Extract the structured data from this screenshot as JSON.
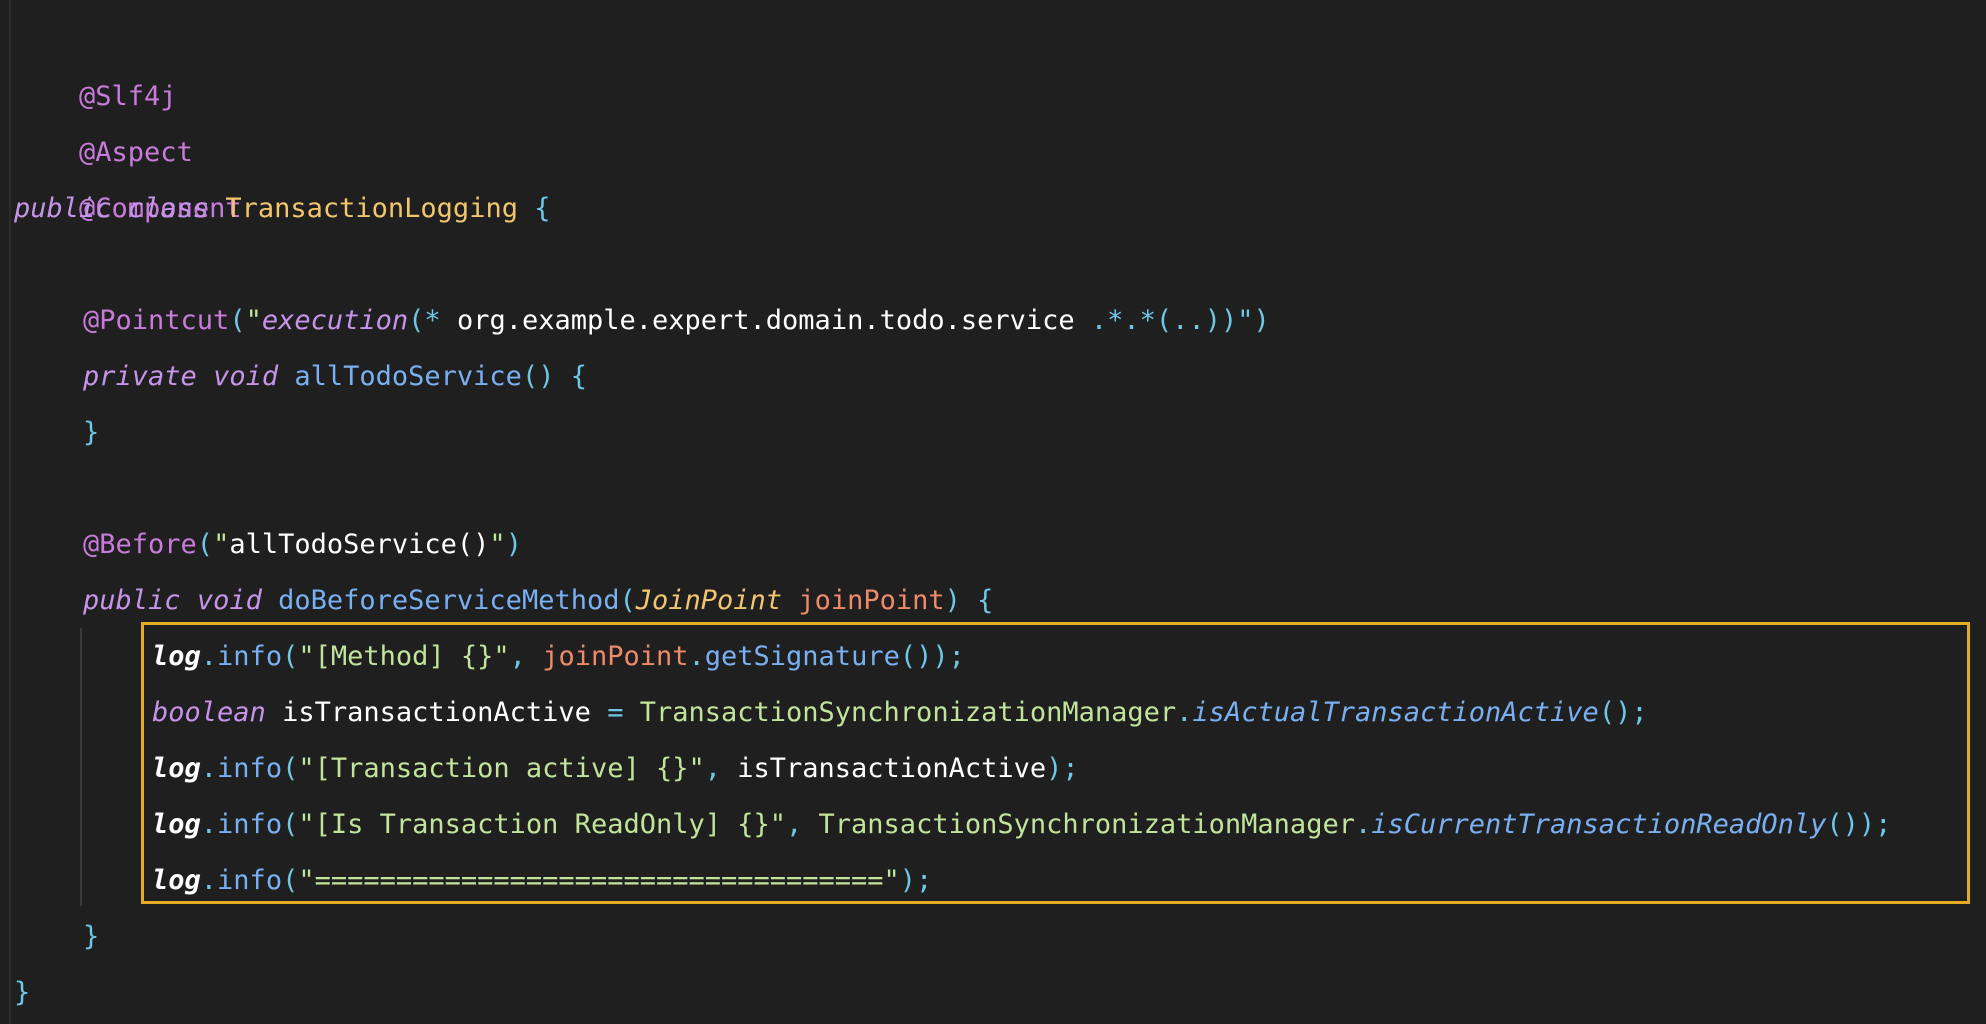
{
  "code": {
    "lines": [
      {
        "y": 0
      },
      {
        "y": 1
      }
    ],
    "annotations": {
      "slf4j": "@Slf4j",
      "aspect": "@Aspect",
      "component": "@Component",
      "pointcut": "@Pointcut",
      "before": "@Before"
    },
    "keywords": {
      "public": "public",
      "class": "class",
      "private": "private",
      "void": "void",
      "boolean": "boolean"
    },
    "class_name": "TransactionLogging",
    "pointcut_expr": {
      "open": "(\"",
      "execution": "execution",
      "rest_paren": "(",
      "star": "*",
      "pkg": " org.example.expert.domain.todo.service ",
      "tail": ".*.*(..))\")"
    },
    "method_all_todo": "allTodoService",
    "before_arg": "allTodoService()",
    "method_before": "doBeforeServiceMethod",
    "param_type": "JoinPoint",
    "param_name": "joinPoint",
    "log": "log",
    "info": "info",
    "str_method": "\"[Method] {}\"",
    "get_signature": "getSignature",
    "var_active": "isTransactionActive",
    "tsm": "TransactionSynchronizationManager",
    "is_actual": "isActualTransactionActive",
    "str_tx_active": "\"[Transaction active] {}\"",
    "str_readonly": "\"[Is Transaction ReadOnly] {}\"",
    "is_readonly": "isCurrentTransactionReadOnly",
    "str_sep": "\"===================================\""
  }
}
